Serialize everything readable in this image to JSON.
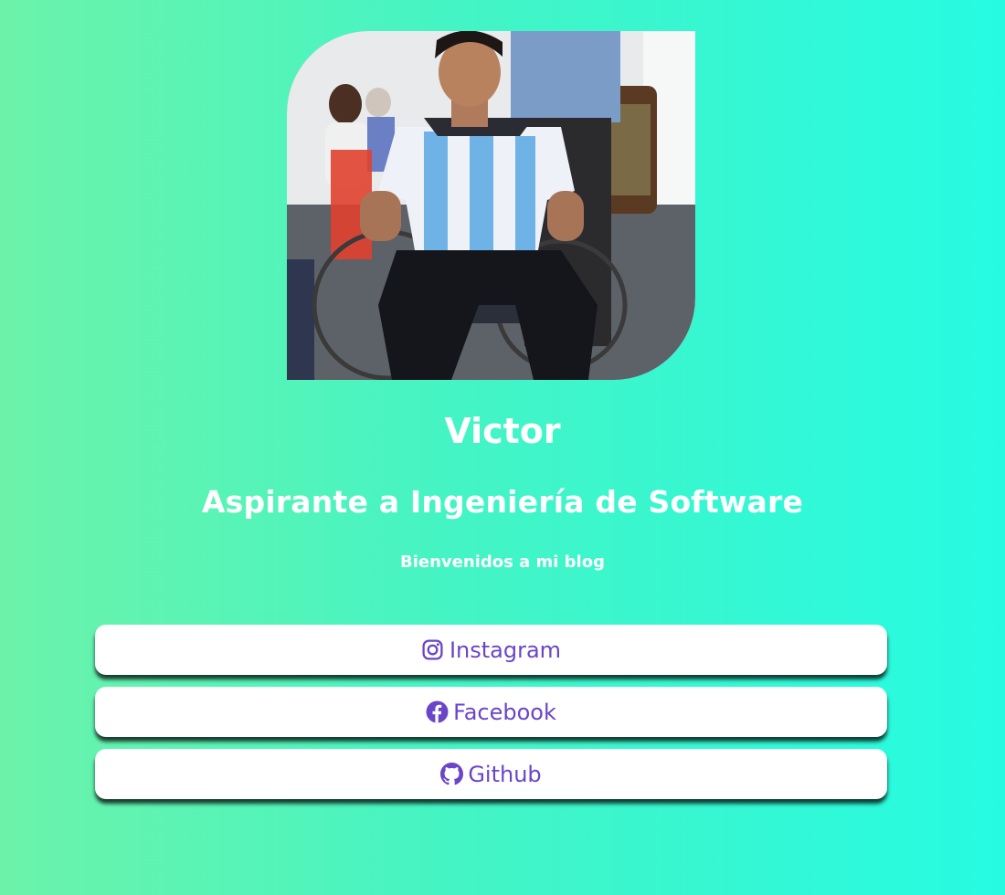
{
  "profile": {
    "name": "Victor",
    "headline": "Aspirante a Ingeniería de Software",
    "tagline": "Bienvenidos a mi blog"
  },
  "links": [
    {
      "label": "Instagram",
      "icon": "instagram-icon"
    },
    {
      "label": "Facebook",
      "icon": "facebook-icon"
    },
    {
      "label": "Github",
      "icon": "github-icon"
    }
  ],
  "colors": {
    "background_start": "#6cf3a9",
    "background_end": "#26fbe2",
    "text": "#ffffff",
    "link_text": "#6a45c8",
    "button_bg": "#ffffff"
  }
}
